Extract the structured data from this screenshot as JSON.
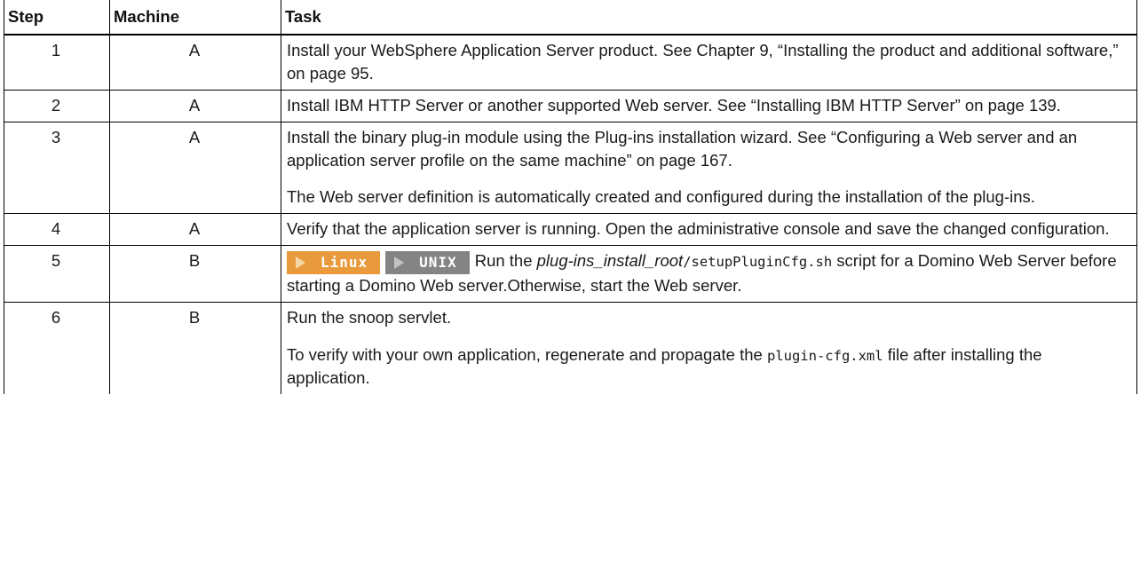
{
  "table": {
    "headers": [
      "Step",
      "Machine",
      "Task"
    ],
    "rows": [
      {
        "step": "1",
        "machine": "A",
        "task": "Install your WebSphere Application Server product. See Chapter 9, “Installing the product and additional software,” on page 95."
      },
      {
        "step": "2",
        "machine": "A",
        "task": "Install IBM HTTP Server or another supported Web server. See “Installing IBM HTTP Server” on page 139."
      },
      {
        "step": "3",
        "machine": "A",
        "task": "Install the binary plug-in module using the Plug-ins installation wizard. See “Configuring a Web server and an application server profile on the same machine” on page 167.",
        "task_note": "The Web server definition is automatically created and configured during the installation of the plug-ins."
      },
      {
        "step": "4",
        "machine": "A",
        "task": "Verify that the application server is running. Open the administrative console and save the changed configuration."
      },
      {
        "step": "5",
        "machine": "B",
        "badges": {
          "linux": "Linux",
          "unix": "UNIX",
          "colors": {
            "linux": "#e99a3d",
            "unix": "#848484"
          }
        },
        "task_prefix": "Run the ",
        "task_italic": "plug-ins_install_root",
        "task_code": "/setupPluginCfg.sh",
        "task_suffix": " script for a Domino Web Server before starting a Domino Web server.Otherwise, start the Web server."
      },
      {
        "step": "6",
        "machine": "B",
        "task": "Run the snoop servlet.",
        "task_note_prefix": "To verify with your own application, regenerate and propagate the ",
        "task_note_code": "plugin-cfg.xml",
        "task_note_suffix": " file after installing the application."
      }
    ]
  }
}
